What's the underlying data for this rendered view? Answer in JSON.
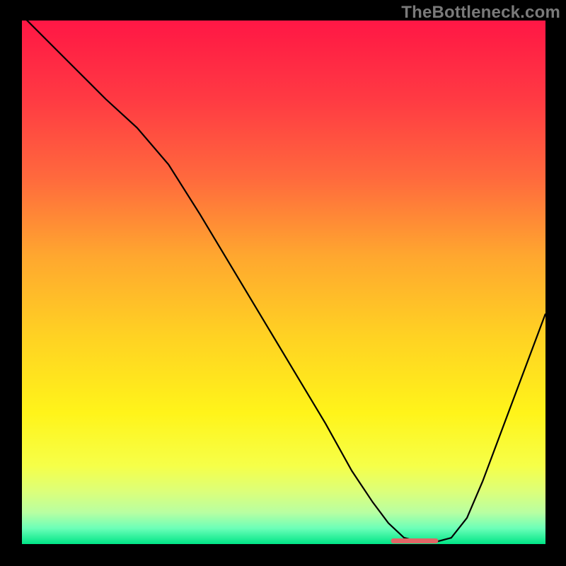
{
  "watermark": "TheBottleneck.com",
  "chart_data": {
    "type": "line",
    "title": "",
    "xlabel": "",
    "ylabel": "",
    "xlim": [
      0,
      100
    ],
    "ylim": [
      0,
      100
    ],
    "grid": false,
    "legend": false,
    "background_gradient": {
      "stops": [
        {
          "offset": 0.0,
          "color": "#ff1745"
        },
        {
          "offset": 0.15,
          "color": "#ff3a43"
        },
        {
          "offset": 0.3,
          "color": "#ff693d"
        },
        {
          "offset": 0.45,
          "color": "#ffa72f"
        },
        {
          "offset": 0.6,
          "color": "#ffd123"
        },
        {
          "offset": 0.75,
          "color": "#fff41a"
        },
        {
          "offset": 0.85,
          "color": "#f6ff48"
        },
        {
          "offset": 0.9,
          "color": "#dcff7a"
        },
        {
          "offset": 0.94,
          "color": "#b8ffa2"
        },
        {
          "offset": 0.97,
          "color": "#6bffb8"
        },
        {
          "offset": 1.0,
          "color": "#00e586"
        }
      ]
    },
    "series": [
      {
        "name": "bottleneck-curve",
        "color": "#000000",
        "x": [
          0,
          5,
          10,
          16,
          22,
          28,
          34,
          40,
          46,
          52,
          58,
          63,
          67,
          70,
          73,
          76,
          79,
          82,
          85,
          88,
          91,
          94,
          97,
          100
        ],
        "values": [
          101,
          96,
          91,
          85,
          79.5,
          72.5,
          63,
          53,
          43,
          33,
          23,
          14,
          8,
          4,
          1.2,
          0.4,
          0.4,
          1.2,
          5,
          12,
          20,
          28,
          36,
          44
        ]
      }
    ],
    "marker": {
      "name": "optimal-range",
      "color": "#e06666",
      "x_start": 70.5,
      "x_end": 79.5,
      "y": 0.6
    }
  }
}
